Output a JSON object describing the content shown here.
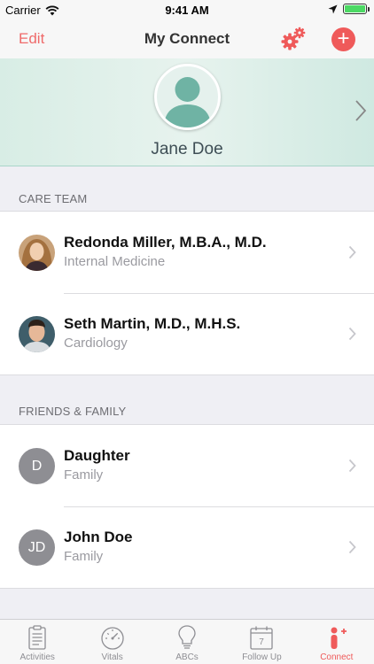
{
  "status_bar": {
    "carrier": "Carrier",
    "time": "9:41 AM",
    "battery_level": 1.0
  },
  "nav": {
    "edit_label": "Edit",
    "title": "My Connect",
    "settings_icon": "gears-icon",
    "add_icon": "plus-circle-icon"
  },
  "profile": {
    "name": "Jane Doe"
  },
  "care_team": {
    "header": "CARE TEAM",
    "members": [
      {
        "name": "Redonda Miller, M.B.A., M.D.",
        "role": "Internal Medicine"
      },
      {
        "name": "Seth Martin, M.D., M.H.S.",
        "role": "Cardiology"
      }
    ]
  },
  "friends_family": {
    "header": "FRIENDS & FAMILY",
    "members": [
      {
        "initials": "D",
        "name": "Daughter",
        "role": "Family"
      },
      {
        "initials": "JD",
        "name": "John Doe",
        "role": "Family"
      }
    ]
  },
  "tabs": [
    {
      "label": "Activities",
      "icon": "clipboard-icon"
    },
    {
      "label": "Vitals",
      "icon": "gauge-icon"
    },
    {
      "label": "ABCs",
      "icon": "lightbulb-icon"
    },
    {
      "label": "Follow Up",
      "icon": "calendar-icon",
      "calendar_day": "7"
    },
    {
      "label": "Connect",
      "icon": "person-plus-icon",
      "active": true
    }
  ],
  "colors": {
    "accent": "#ef5a5a",
    "profile_bg": "#d8ede5"
  }
}
